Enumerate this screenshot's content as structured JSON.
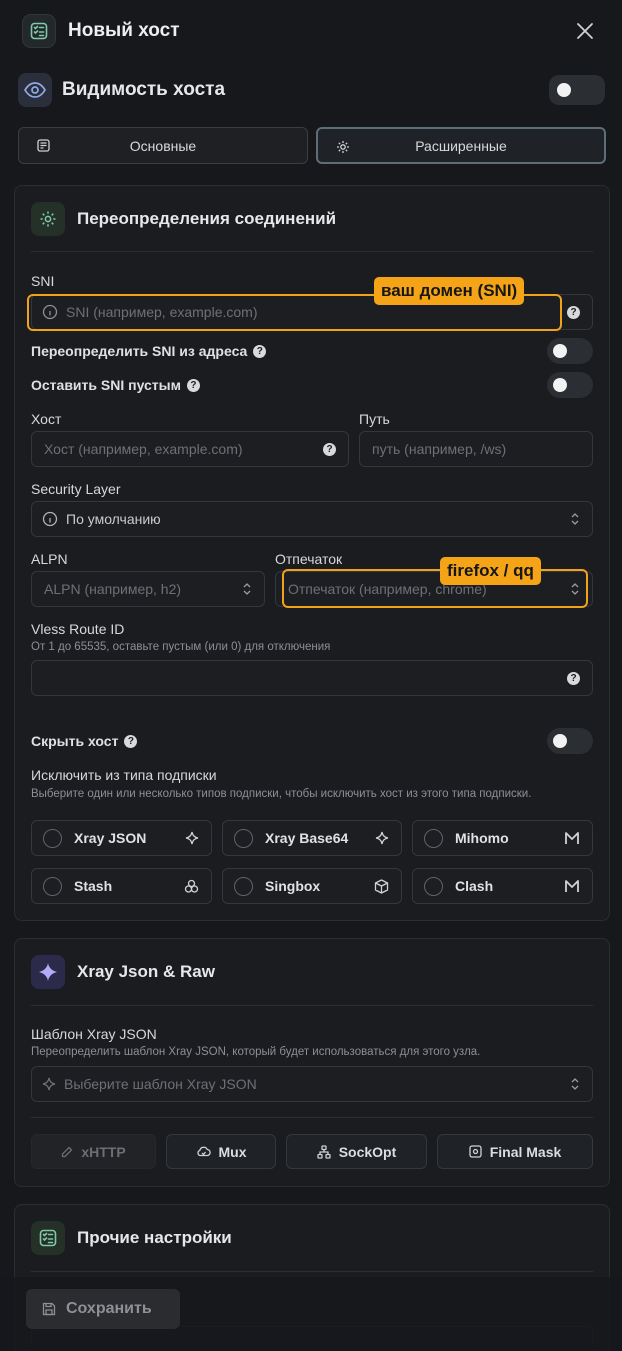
{
  "header": {
    "title": "Новый хост"
  },
  "visibility": {
    "label": "Видимость хоста"
  },
  "tabs": [
    {
      "label": "Основные"
    },
    {
      "label": "Расширенные"
    }
  ],
  "connection": {
    "title": "Переопределения соединений",
    "sni": {
      "label": "SNI",
      "placeholder": "SNI (например, example.com)",
      "annotation": "ваш домен (SNI)"
    },
    "override_sni": {
      "label": "Переопределить SNI из адреса"
    },
    "empty_sni": {
      "label": "Оставить SNI пустым"
    },
    "host": {
      "label": "Хост",
      "placeholder": "Хост (например, example.com)"
    },
    "path": {
      "label": "Путь",
      "placeholder": "путь (например, /ws)"
    },
    "security": {
      "label": "Security Layer",
      "value": "По умолчанию"
    },
    "alpn": {
      "label": "ALPN",
      "placeholder": "ALPN (например, h2)"
    },
    "fingerprint": {
      "label": "Отпечаток",
      "placeholder": "Отпечаток (например, chrome)",
      "annotation": "firefox / qq"
    },
    "vless_route": {
      "label": "Vless Route ID",
      "hint": "От 1 до 65535, оставьте пустым (или 0) для отключения"
    },
    "hide_host": {
      "label": "Скрыть хост"
    },
    "exclude": {
      "label": "Исключить из типа подписки",
      "hint": "Выберите один или несколько типов подписки, чтобы исключить хост из этого типа подписки.",
      "options": [
        {
          "label": "Xray JSON",
          "icon": "sparkle-icon"
        },
        {
          "label": "Xray Base64",
          "icon": "sparkle-icon"
        },
        {
          "label": "Mihomo",
          "icon": "m-logo-icon"
        },
        {
          "label": "Stash",
          "icon": "triple-circle-icon"
        },
        {
          "label": "Singbox",
          "icon": "box-icon"
        },
        {
          "label": "Clash",
          "icon": "m-logo-icon"
        }
      ]
    }
  },
  "xray": {
    "title": "Xray Json & Raw",
    "template": {
      "label": "Шаблон Xray JSON",
      "hint": "Переопределить шаблон Xray JSON, который будет использоваться для этого узла.",
      "placeholder": "Выберите шаблон Xray JSON"
    },
    "buttons": [
      {
        "label": "xHTTP"
      },
      {
        "label": "Mux"
      },
      {
        "label": "SockOpt"
      },
      {
        "label": "Final Mask"
      }
    ]
  },
  "other": {
    "title": "Прочие настройки"
  },
  "footer": {
    "save_label": "Сохранить"
  },
  "colors": {
    "accent": "#f5a417",
    "background": "#16181c",
    "card": "#1a1c20"
  }
}
